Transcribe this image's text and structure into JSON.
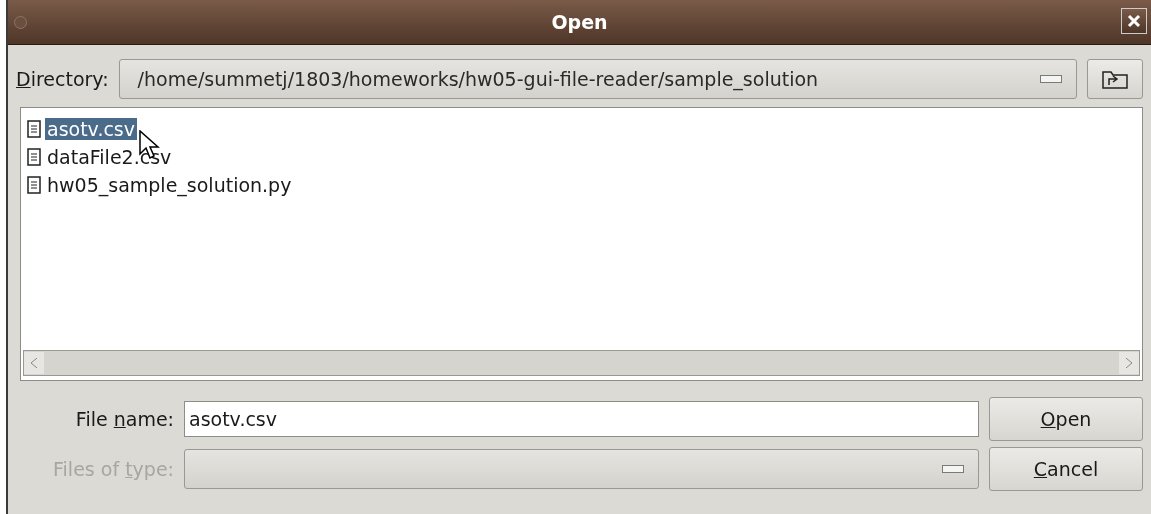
{
  "window": {
    "title": "Open"
  },
  "directory": {
    "label": {
      "key": "D",
      "after": "irectory:"
    },
    "value": "/home/summetj/1803/homeworks/hw05-gui-file-reader/sample_solution"
  },
  "files": [
    {
      "name": "asotv.csv",
      "selected": true
    },
    {
      "name": "dataFile2.csv",
      "selected": false
    },
    {
      "name": "hw05_sample_solution.py",
      "selected": false
    }
  ],
  "file_name": {
    "label": {
      "before": "File ",
      "key": "n",
      "after": "ame:"
    },
    "value": "asotv.csv"
  },
  "file_type": {
    "label": {
      "before": "Files of ",
      "key": "t",
      "after": "ype:"
    },
    "disabled": true
  },
  "buttons": [
    {
      "key": "O",
      "after": "pen"
    },
    {
      "key": "C",
      "after": "ancel"
    }
  ]
}
